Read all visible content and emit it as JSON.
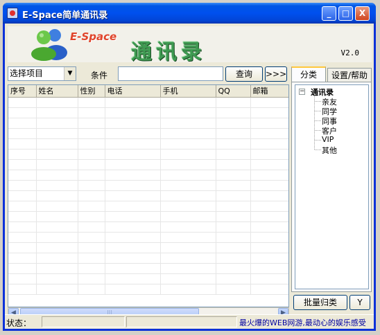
{
  "window": {
    "title": "E-Space简单通讯录",
    "minimize": "_",
    "maximize": "□",
    "close": "X"
  },
  "banner": {
    "brand": "E-Space",
    "title": "通讯录",
    "version": "V2.0"
  },
  "search": {
    "select_value": "选择项目",
    "condition_label": "条件",
    "condition_value": "",
    "query_button": "查询",
    "more_button": ">>>"
  },
  "grid": {
    "columns": [
      "序号",
      "姓名",
      "性别",
      "电话",
      "手机",
      "QQ",
      "邮箱"
    ]
  },
  "tabs": {
    "category": "分类",
    "settings_help": "设置/帮助"
  },
  "tree": {
    "expander": "−",
    "root": "通讯录",
    "children": [
      "亲友",
      "同学",
      "同事",
      "客户",
      "VIP",
      "其他"
    ]
  },
  "actions": {
    "batch_button": "批量归类",
    "y_button": "Y"
  },
  "status": {
    "label": "状态：",
    "ad": "最火爆的WEB网游,最动心的娱乐感受"
  },
  "colors": {
    "titlebar": "#0050ee",
    "brand": "#e0442a",
    "banner_title": "#3f9a52",
    "ad_text": "#0000a0"
  }
}
